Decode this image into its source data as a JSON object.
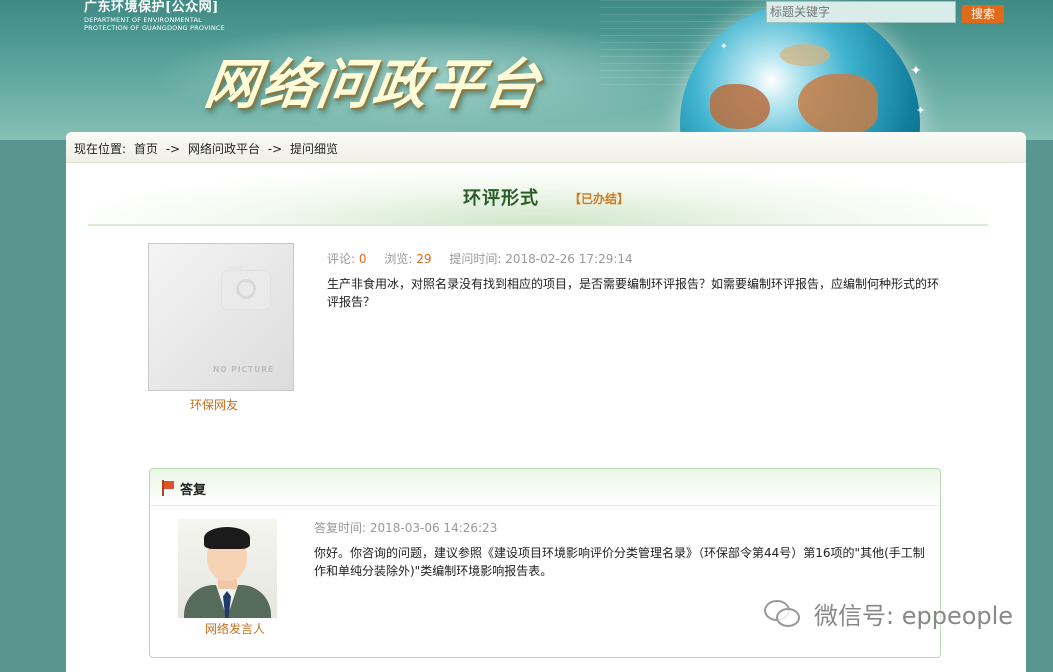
{
  "header": {
    "logo": {
      "name_cn": "广东环境保护[公众网]",
      "dept_en_line1": "DEPARTMENT OF ENVIRONMENTAL",
      "dept_en_line2": "PROTECTION OF GUANGDONG PROVINCE"
    },
    "site_title": "网络问政平台",
    "search": {
      "placeholder": "标题关键字",
      "button_label": "搜索"
    }
  },
  "breadcrumb": {
    "label": "现在位置:",
    "items": [
      "首页",
      "->",
      "网络问政平台",
      "->",
      "提问细览"
    ]
  },
  "question": {
    "title": "环评形式",
    "status": "【已办结】",
    "asker_image_text": "NO PICTURE",
    "asker_name": "环保网友",
    "comments_label": "评论:",
    "comments": "0",
    "views_label": "浏览:",
    "views": "29",
    "time_label": "提问时间:",
    "time": "2018-02-26 17:29:14",
    "body": "生产非食用冰，对照名录没有找到相应的项目，是否需要编制环评报告？如需要编制环评报告，应编制何种形式的环评报告？"
  },
  "answer": {
    "heading": "答复",
    "time_label": "答复时间:",
    "time": "2018-03-06 14:26:23",
    "responder_name": "网络发言人",
    "body": "你好。你咨询的问题，建议参照《建设项目环境影响评价分类管理名录》（环保部令第44号）第16项的\"其他(手工制作和单纯分装除外)\"类编制环境影响报告表。"
  },
  "watermark": {
    "text": "微信号: eppeople"
  },
  "colors": {
    "accent": "#e06a1c",
    "title_green": "#2a5c2a",
    "name_orange": "#c07020"
  }
}
